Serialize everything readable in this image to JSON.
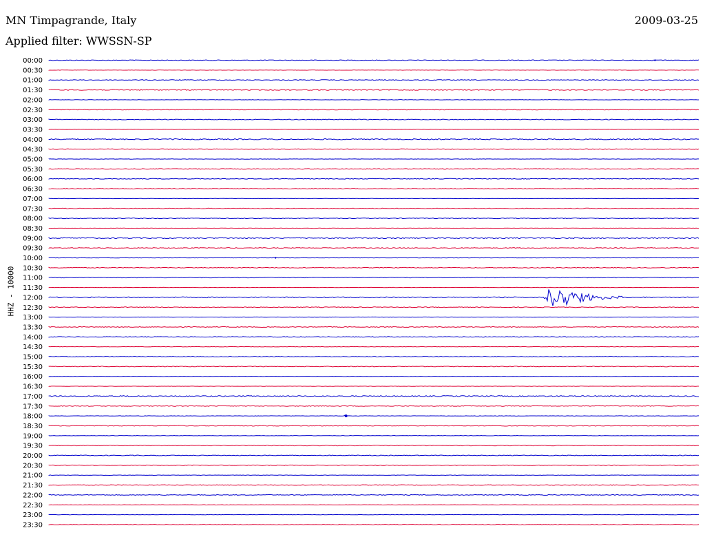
{
  "header": {
    "title": "MN Timpagrande, Italy",
    "date": "2009-03-25",
    "filter": "Applied filter: WWSSN-SP"
  },
  "y_axis_label": "HHZ - 10000",
  "colors": {
    "even": "#0000cc",
    "odd": "#dd0033"
  },
  "chart_data": {
    "type": "line",
    "title": "MN Timpagrande, Italy",
    "subtitle": "Applied filter: WWSSN-SP",
    "ylabel": "HHZ - 10000",
    "xlabel": "",
    "grid": false,
    "rows": [
      "00:00",
      "00:30",
      "01:00",
      "01:30",
      "02:00",
      "02:30",
      "03:00",
      "03:30",
      "04:00",
      "04:30",
      "05:00",
      "05:30",
      "06:00",
      "06:30",
      "07:00",
      "07:30",
      "08:00",
      "08:30",
      "09:00",
      "09:30",
      "10:00",
      "10:30",
      "11:00",
      "11:30",
      "12:00",
      "12:30",
      "13:00",
      "13:30",
      "14:00",
      "14:30",
      "15:00",
      "15:30",
      "16:00",
      "16:30",
      "17:00",
      "17:30",
      "18:00",
      "18:30",
      "19:00",
      "19:30",
      "20:00",
      "20:30",
      "21:00",
      "21:30",
      "22:00",
      "22:30",
      "23:00",
      "23:30"
    ],
    "row_noise": [
      1,
      0.5,
      1,
      1.5,
      0.5,
      1,
      1,
      0.5,
      1.5,
      1,
      0.5,
      1,
      1,
      1,
      0.5,
      1,
      1,
      0.5,
      1.5,
      1,
      0.5,
      1,
      1,
      0.5,
      1.5,
      1,
      0.5,
      1,
      1,
      0.5,
      1,
      1,
      0.5,
      0.5,
      1.5,
      1,
      0.5,
      1,
      0.5,
      1,
      1,
      1,
      0.5,
      1,
      1,
      0.5,
      0.5,
      1
    ],
    "events": [
      {
        "row": "12:00",
        "minute_start": 22.8,
        "minute_end": 26.5,
        "amplitude": 21
      },
      {
        "row": "18:00",
        "minute_start": 13.6,
        "minute_end": 13.8,
        "amplitude": 2
      },
      {
        "row": "10:00",
        "minute_start": 10.3,
        "minute_end": 10.6,
        "amplitude": 1.5
      },
      {
        "row": "00:00",
        "minute_start": 27.8,
        "minute_end": 28.1,
        "amplitude": 1.5
      }
    ]
  }
}
